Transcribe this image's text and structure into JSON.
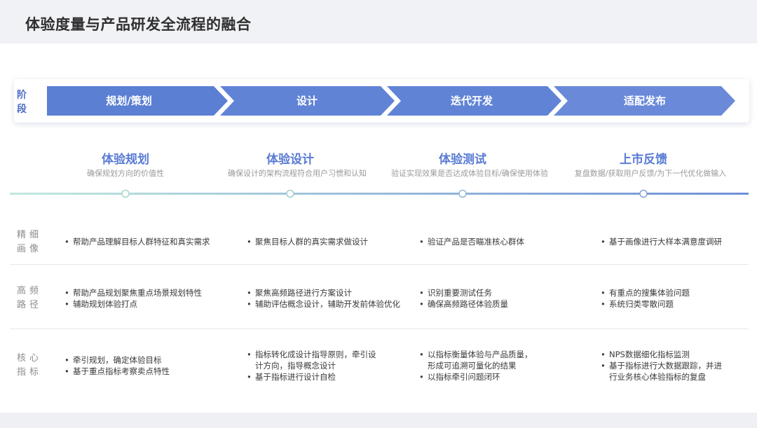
{
  "page_title": "体验度量与产品研发全流程的融合",
  "stage_label": "阶段",
  "stages": [
    "规划/策划",
    "设计",
    "迭代开发",
    "适配发布"
  ],
  "colors": {
    "accent": "#5b7fd3",
    "arrow_light": "#6a8ad9",
    "title_blue": "#5a7bd4",
    "timeline_start": "#b8e3d8",
    "timeline_end": "#6f8fd8",
    "node_stroke": "#9bd8c3"
  },
  "phases": [
    {
      "title": "体验规划",
      "subtitle": "确保规划方向的价值性"
    },
    {
      "title": "体验设计",
      "subtitle": "确保设计的架构流程符合用户习惯和认知"
    },
    {
      "title": "体验测试",
      "subtitle": "验证实现效果是否达成体验目标/确保使用体验"
    },
    {
      "title": "上市反馈",
      "subtitle": "复盘数据/获取用户反馈/为下一代优化做输入"
    }
  ],
  "rows": [
    {
      "label": "精细画像",
      "cells": [
        [
          "帮助产品理解目标人群特征和真实需求"
        ],
        [
          "聚焦目标人群的真实需求做设计"
        ],
        [
          "验证产品是否瞄准核心群体"
        ],
        [
          "基于画像进行大样本满意度调研"
        ]
      ]
    },
    {
      "label": "高频路径",
      "cells": [
        [
          "帮助产品规划聚焦重点场景规划特性",
          "辅助规划体验打点"
        ],
        [
          "聚焦高频路径进行方案设计",
          "辅助评估概念设计，辅助开发前体验优化"
        ],
        [
          "识别重要测试任务",
          "确保高频路径体验质量"
        ],
        [
          "有重点的搜集体验问题",
          "系统归类零散问题"
        ]
      ]
    },
    {
      "label": "核心指标",
      "cells": [
        [
          "牵引规划，确定体验目标",
          "基于重点指标考察卖点特性"
        ],
        [
          "指标转化成设计指导原则，牵引设计方向，指导概念设计",
          "基于指标进行设计自检"
        ],
        [
          "以指标衡量体验与产品质量，形成可追溯可量化的结果",
          "以指标牵引问题闭环"
        ],
        [
          "NPS数据细化指标监测",
          "基于指标进行大数据跟踪，并进行业务核心体验指标的复盘"
        ]
      ]
    }
  ]
}
